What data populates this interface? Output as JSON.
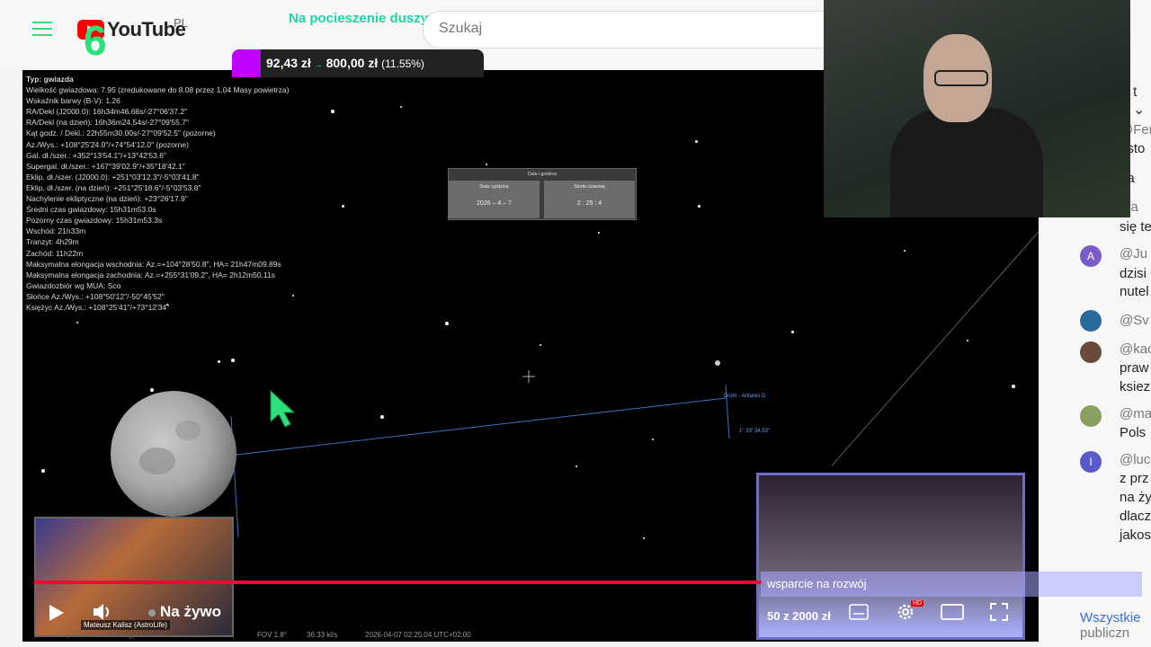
{
  "header": {
    "brand": "YouTube",
    "region": "PL",
    "channel_logo": "6",
    "banner": "Na pocieszenie duszy",
    "search_placeholder": "Szukaj"
  },
  "donation": {
    "current": "92,43 zł",
    "target": "800,00 zł",
    "percent": "(11.55%)",
    "color": "#c000ff"
  },
  "starmap": {
    "info_lines": [
      "Typ: gwiazda",
      "Wielkość gwiazdowa: 7.95 (zredukowane do 8.08 przez 1.04 Masy powietrza)",
      "Wskaźnik barwy (B-V): 1.26",
      "RA/Dekl (J2000.0): 16h34m46.68s/-27°06'37.2\"",
      "RA/Dekl (na dzień): 16h36m24.54s/-27°09'55.7\"",
      "Kąt godz. / Dekl.: 22h55m30.00s/-27°09'52.5\" (pozorne)",
      "Az./Wys.: +108°25'24.0\"/+74°54'12.0\" (pozorne)",
      "Gal. dł./szer.: +352°13'54.1\"/+13°42'53.6\"",
      "Supergal. dł./szer.: +167°39'02.9\"/+35°18'42.1\"",
      "Eklip. dł./szer. (J2000.0): +251°03'12.3\"/-5°03'41.8\"",
      "Eklip. dł./szer. (na dzień): +251°25'18.6\"/-5°03'53.8\"",
      "Nachylenie ekliptyczne (na dzień): +23°26'17.9\"",
      "Średni czas gwiazdowy: 15h31m53.0s",
      "Pozorny czas gwiazdowy: 15h31m53.3s",
      "Wschód: 21h33m",
      "Tranzyt: 4h29m",
      "Zachód: 11h22m",
      "Maksymalna elongacja wschodnia: Az.=+104°28'50.8\", HA= 21h47m09.89s",
      "Maksymalna elongacja zachodnia: Az.=+255°31'09.2\", HA= 2h12m50.11s",
      "Gwiazdozbiór wg MUA: Sco",
      "Słońce Az./Wys.: +108°50'12\"/-50°45'52\"",
      "Księżyc Az./Wys.: +108°25'41\"/+73°12'34\""
    ],
    "dialog": {
      "title": "Data i godzina",
      "date_header": "Data i godzina",
      "date_value": "2026 – 4 – 7",
      "time_header": "Strefa czasowa",
      "time_value": "2 : 25 : 4"
    },
    "target_label": "Drom - Antares D",
    "angle_label": "1° 33' 34.53\"",
    "status": {
      "location": "Ziemia, Hakos Observatory, 1820 m",
      "fov": "FOV 1.8°",
      "fps": "36.33 kl/s",
      "datetime": "2026-04-07 02:25:04 UTC+02:00"
    }
  },
  "chat": {
    "top_fragment": "t",
    "messages": [
      {
        "author": "@Fer",
        "text": "asto",
        "avatar": "#b0b0b0"
      },
      {
        "author": "",
        "text": "ga",
        "avatar": "#c8c8c8"
      },
      {
        "author": "ma",
        "text": "się te",
        "avatar": "#888888"
      },
      {
        "author": "@Ju",
        "text": "dzisi",
        "extra": "nutel",
        "avatar": "#7a5cc8",
        "initial": "A"
      },
      {
        "author": "@Sv",
        "text": "",
        "avatar": "#2a6a9a"
      },
      {
        "author": "@kac",
        "text": "praw",
        "extra": "ksiez",
        "avatar": "#6a4a3a"
      },
      {
        "author": "@ma",
        "text": "Pols",
        "avatar": "#8aa060"
      },
      {
        "author": "@luc",
        "text": "z prz",
        "extra": "na ży",
        "extra2": "dlacz",
        "extra3": "jakos",
        "avatar": "#5a5ac8",
        "initial": "I"
      }
    ],
    "footer": "Wszystkie",
    "footer2": "publiczn"
  },
  "player": {
    "live_label": "Na żywo",
    "progress_color": "#ff0033",
    "pip_left_name": "Mateusz Kalisz (AstroLife)",
    "goal_text": "wsparcie na rozwój",
    "goal_count": "50 z 2000 zł",
    "hd_badge": "HD"
  }
}
